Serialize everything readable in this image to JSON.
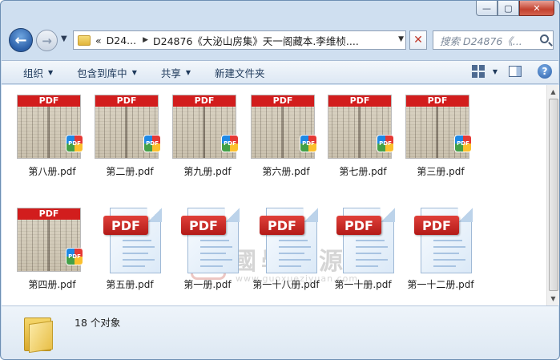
{
  "window": {
    "caption_buttons": {
      "minimize": "—",
      "maximize": "▢",
      "close": "✕"
    }
  },
  "nav": {
    "back_icon": "back-arrow-icon",
    "forward_icon": "forward-arrow-icon",
    "breadcrumb_overflow": "«",
    "breadcrumb": [
      "D24...",
      "D24876《大泌山房集》天一阁藏本.李维桢...."
    ],
    "stop_label": "✕",
    "search_placeholder": "搜索 D24876《..."
  },
  "toolbar": {
    "organize": "组织",
    "include_in_library": "包含到库中",
    "share": "共享",
    "new_folder": "新建文件夹",
    "help": "?"
  },
  "files": [
    {
      "name": "第八册.pdf",
      "kind": "thumbnail"
    },
    {
      "name": "第二册.pdf",
      "kind": "thumbnail"
    },
    {
      "name": "第九册.pdf",
      "kind": "thumbnail"
    },
    {
      "name": "第六册.pdf",
      "kind": "thumbnail"
    },
    {
      "name": "第七册.pdf",
      "kind": "thumbnail"
    },
    {
      "name": "第三册.pdf",
      "kind": "thumbnail"
    },
    {
      "name": "第四册.pdf",
      "kind": "thumbnail"
    },
    {
      "name": "第五册.pdf",
      "kind": "pdf-icon"
    },
    {
      "name": "第一册.pdf",
      "kind": "pdf-icon"
    },
    {
      "name": "第一十八册.pdf",
      "kind": "pdf-icon"
    },
    {
      "name": "第一十册.pdf",
      "kind": "pdf-icon"
    },
    {
      "name": "第一十二册.pdf",
      "kind": "pdf-icon"
    }
  ],
  "thumb_banner": "PDF",
  "thumb_badge": "PDF",
  "doc_label": "PDF",
  "watermark": {
    "seal": "國",
    "title": "國學資源網",
    "url": "www.guoxueziyuan.com"
  },
  "status": {
    "item_count": "18 个对象"
  },
  "colors": {
    "pdf_red": "#d21d1d",
    "window_frame": "#cfdff0",
    "close_button": "#c3422f"
  }
}
